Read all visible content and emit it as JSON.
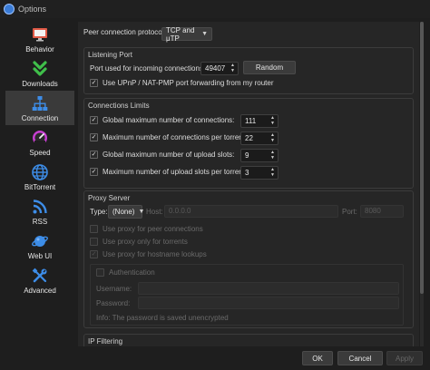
{
  "window": {
    "title": "Options"
  },
  "sidebar": {
    "items": [
      {
        "label": "Behavior",
        "icon": "monitor-icon"
      },
      {
        "label": "Downloads",
        "icon": "double-chevron-down-icon"
      },
      {
        "label": "Connection",
        "icon": "network-icon",
        "active": true
      },
      {
        "label": "Speed",
        "icon": "speedometer-icon"
      },
      {
        "label": "BitTorrent",
        "icon": "globe-icon"
      },
      {
        "label": "RSS",
        "icon": "rss-icon"
      },
      {
        "label": "Web UI",
        "icon": "planet-icon"
      },
      {
        "label": "Advanced",
        "icon": "wrench-screwdriver-icon"
      }
    ]
  },
  "connection": {
    "protocol_label": "Peer connection protocol:",
    "protocol_value": "TCP and μTP",
    "listening_port": {
      "title": "Listening Port",
      "port_label": "Port used for incoming connections:",
      "port_value": "49407",
      "random_label": "Random",
      "upnp_label": "Use UPnP / NAT-PMP port forwarding from my router",
      "upnp_checked": true
    },
    "limits": {
      "title": "Connections Limits",
      "rows": [
        {
          "label": "Global maximum number of connections:",
          "value": "111",
          "checked": true
        },
        {
          "label": "Maximum number of connections per torrent:",
          "value": "22",
          "checked": true
        },
        {
          "label": "Global maximum number of upload slots:",
          "value": "9",
          "checked": true
        },
        {
          "label": "Maximum number of upload slots per torrent:",
          "value": "3",
          "checked": true
        }
      ]
    },
    "proxy": {
      "title": "Proxy Server",
      "type_label": "Type:",
      "type_value": "(None)",
      "host_label": "Host:",
      "host_value": "0.0.0.0",
      "port_label": "Port:",
      "port_value": "8080",
      "use_peer_label": "Use proxy for peer connections",
      "use_torrents_label": "Use proxy only for torrents",
      "hostname_lookup_label": "Use proxy for hostname lookups",
      "auth_label": "Authentication",
      "username_label": "Username:",
      "password_label": "Password:",
      "info_label": "Info: The password is saved unencrypted"
    },
    "ip_filtering": {
      "title": "IP Filtering"
    }
  },
  "footer": {
    "ok_label": "OK",
    "cancel_label": "Cancel",
    "apply_label": "Apply"
  }
}
